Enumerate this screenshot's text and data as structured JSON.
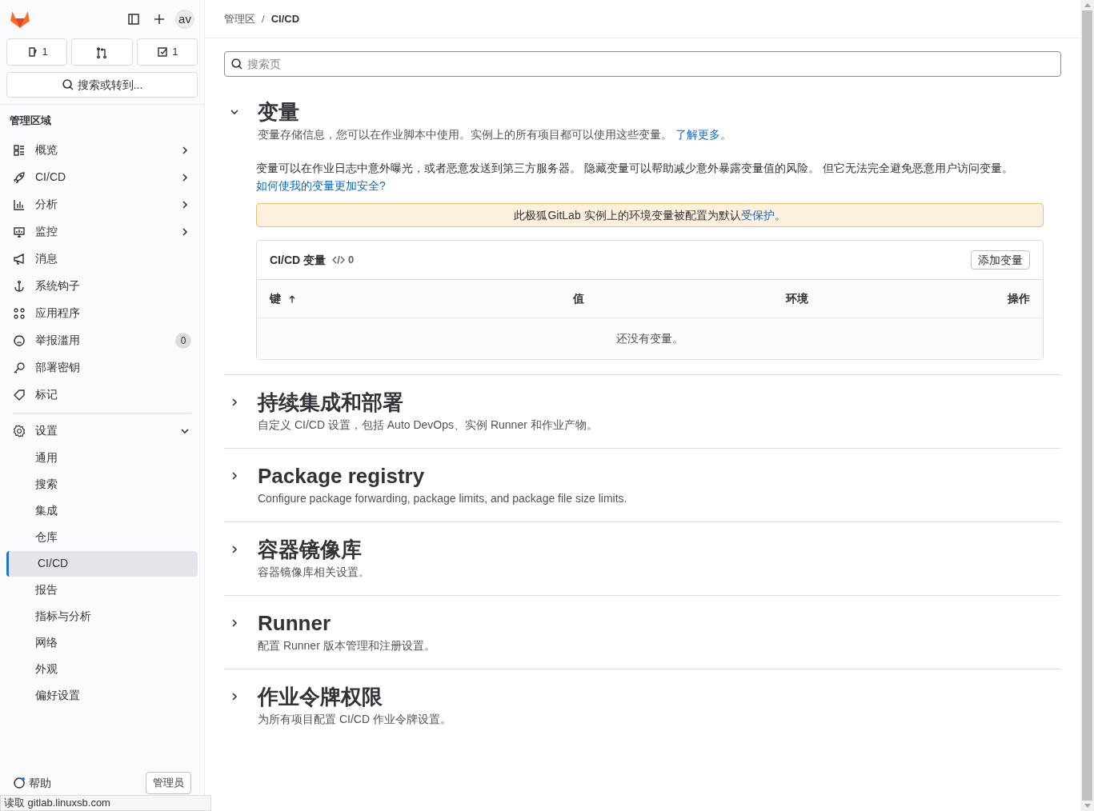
{
  "sidebar": {
    "avatar": "av",
    "counters": [
      {
        "kind": "issues",
        "count": "1"
      },
      {
        "kind": "merge_requests"
      },
      {
        "kind": "todos",
        "count": "1"
      }
    ],
    "search_button": "搜索或转到...",
    "section_title": "管理区域",
    "items": [
      {
        "label": "概览",
        "has_submenu": true
      },
      {
        "label": "CI/CD",
        "has_submenu": true
      },
      {
        "label": "分析",
        "has_submenu": true
      },
      {
        "label": "监控",
        "has_submenu": true
      },
      {
        "label": "消息",
        "has_submenu": false
      },
      {
        "label": "系统钩子",
        "has_submenu": false
      },
      {
        "label": "应用程序",
        "has_submenu": false
      },
      {
        "label": "举报滥用",
        "has_submenu": false,
        "badge": "0"
      },
      {
        "label": "部署密钥",
        "has_submenu": false
      },
      {
        "label": "标记",
        "has_submenu": false
      }
    ],
    "settings": {
      "label": "设置",
      "expanded": true,
      "children": [
        {
          "label": "通用",
          "selected": false
        },
        {
          "label": "搜索",
          "selected": false
        },
        {
          "label": "集成",
          "selected": false
        },
        {
          "label": "仓库",
          "selected": false
        },
        {
          "label": "CI/CD",
          "selected": true
        },
        {
          "label": "报告",
          "selected": false
        },
        {
          "label": "指标与分析",
          "selected": false
        },
        {
          "label": "网络",
          "selected": false
        },
        {
          "label": "外观",
          "selected": false
        },
        {
          "label": "偏好设置",
          "selected": false
        }
      ]
    },
    "footer": {
      "help": "帮助",
      "admin": "管理员"
    }
  },
  "breadcrumb": {
    "separator": "/",
    "items": [
      {
        "label": "管理区"
      },
      {
        "label": "CI/CD"
      }
    ]
  },
  "search": {
    "placeholder": "搜索页"
  },
  "sections": [
    {
      "title": "变量",
      "expanded": true,
      "description": "变量存储信息，您可以在作业脚本中使用。实例上的所有项目都可以使用这些变量。",
      "link": "了解更多。",
      "warning": "变量可以在作业日志中意外曝光，或者恶意发送到第三方服务器。 隐藏变量可以帮助减少意外暴露变量值的风险。 但它无法完全避免恶意用户访问变量。",
      "warning_link": "如何使我的变量更加安全?",
      "alert": "此极狐GitLab 实例上的环境变量被配置为默认",
      "alert_link": "受保护",
      "alert_end": "。",
      "table": {
        "title": "CI/CD 变量",
        "count": "0",
        "add_button": "添加变量",
        "columns": [
          "键",
          "值",
          "环境",
          "操作"
        ],
        "empty": "还没有变量。"
      }
    },
    {
      "title": "持续集成和部署",
      "expanded": false,
      "description": "自定义 CI/CD 设置，包括 Auto DevOps、实例 Runner 和作业产物。"
    },
    {
      "title": "Package registry",
      "expanded": false,
      "description": "Configure package forwarding, package limits, and package file size limits."
    },
    {
      "title": "容器镜像库",
      "expanded": false,
      "description": "容器镜像库相关设置。"
    },
    {
      "title": "Runner",
      "expanded": false,
      "description": "配置 Runner 版本管理和注册设置。"
    },
    {
      "title": "作业令牌权限",
      "expanded": false,
      "description": "为所有项目配置 CI/CD 作业令牌设置。"
    }
  ],
  "status_bar": "读取 gitlab.linuxsb.com"
}
